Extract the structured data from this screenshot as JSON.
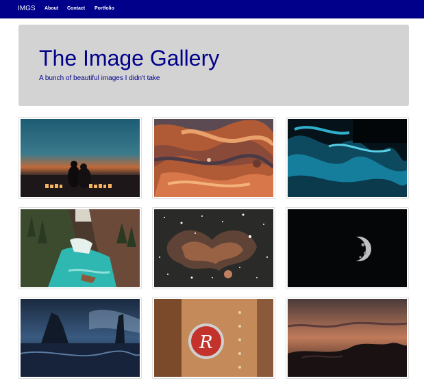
{
  "navbar": {
    "brand": "IMGS",
    "links": [
      "About",
      "Contact",
      "Portfolio"
    ],
    "color": "#00008b"
  },
  "jumbotron": {
    "title": "The Image Gallery",
    "subtitle": "A bunch of beautiful images I didn't take"
  },
  "gallery": {
    "images": [
      {
        "subject": "couple-sunset-candles"
      },
      {
        "subject": "abstract-paint-swirl"
      },
      {
        "subject": "teal-abstract-texture"
      },
      {
        "subject": "river-canyon"
      },
      {
        "subject": "nebula-starfield"
      },
      {
        "subject": "half-moon"
      },
      {
        "subject": "sea-stacks-night"
      },
      {
        "subject": "baseball-glove-logo"
      },
      {
        "subject": "dusk-clouds"
      }
    ]
  }
}
